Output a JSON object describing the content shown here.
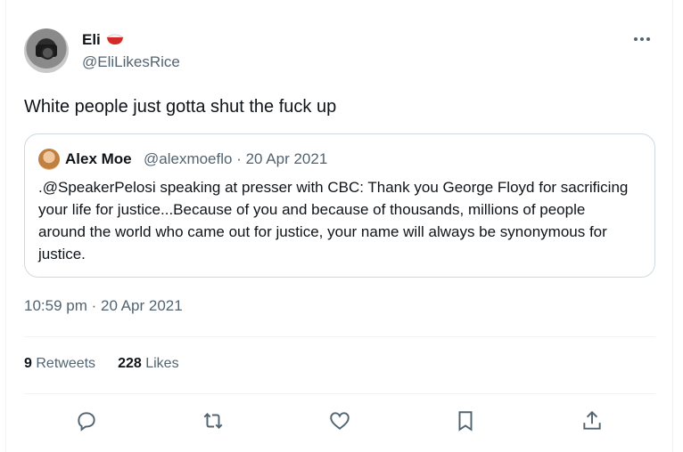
{
  "tweet": {
    "author_name": "Eli",
    "author_emoji_icon": "rice-bowl-icon",
    "author_handle": "@EliLikesRice",
    "text": "White people just gotta shut the fuck up",
    "timestamp": "10:59 pm · 20 Apr 2021"
  },
  "quoted": {
    "author_name": "Alex Moe",
    "author_handle": "@alexmoeflo",
    "date": "· 20 Apr 2021",
    "text": ".@SpeakerPelosi speaking at presser with CBC: Thank you George Floyd for sacrificing your life for justice...Because of you and because of thousands, millions of people around the world who came out for justice, your name will always be synonymous for justice."
  },
  "stats": {
    "retweets_count": "9",
    "retweets_label": "Retweets",
    "likes_count": "228",
    "likes_label": "Likes"
  },
  "actions": [
    "reply-icon",
    "retweet-icon",
    "like-icon",
    "bookmark-icon",
    "share-icon"
  ],
  "colors": {
    "text": "#0f1419",
    "secondary": "#536471",
    "border": "#cfd9de",
    "divider": "#eff3f4"
  }
}
